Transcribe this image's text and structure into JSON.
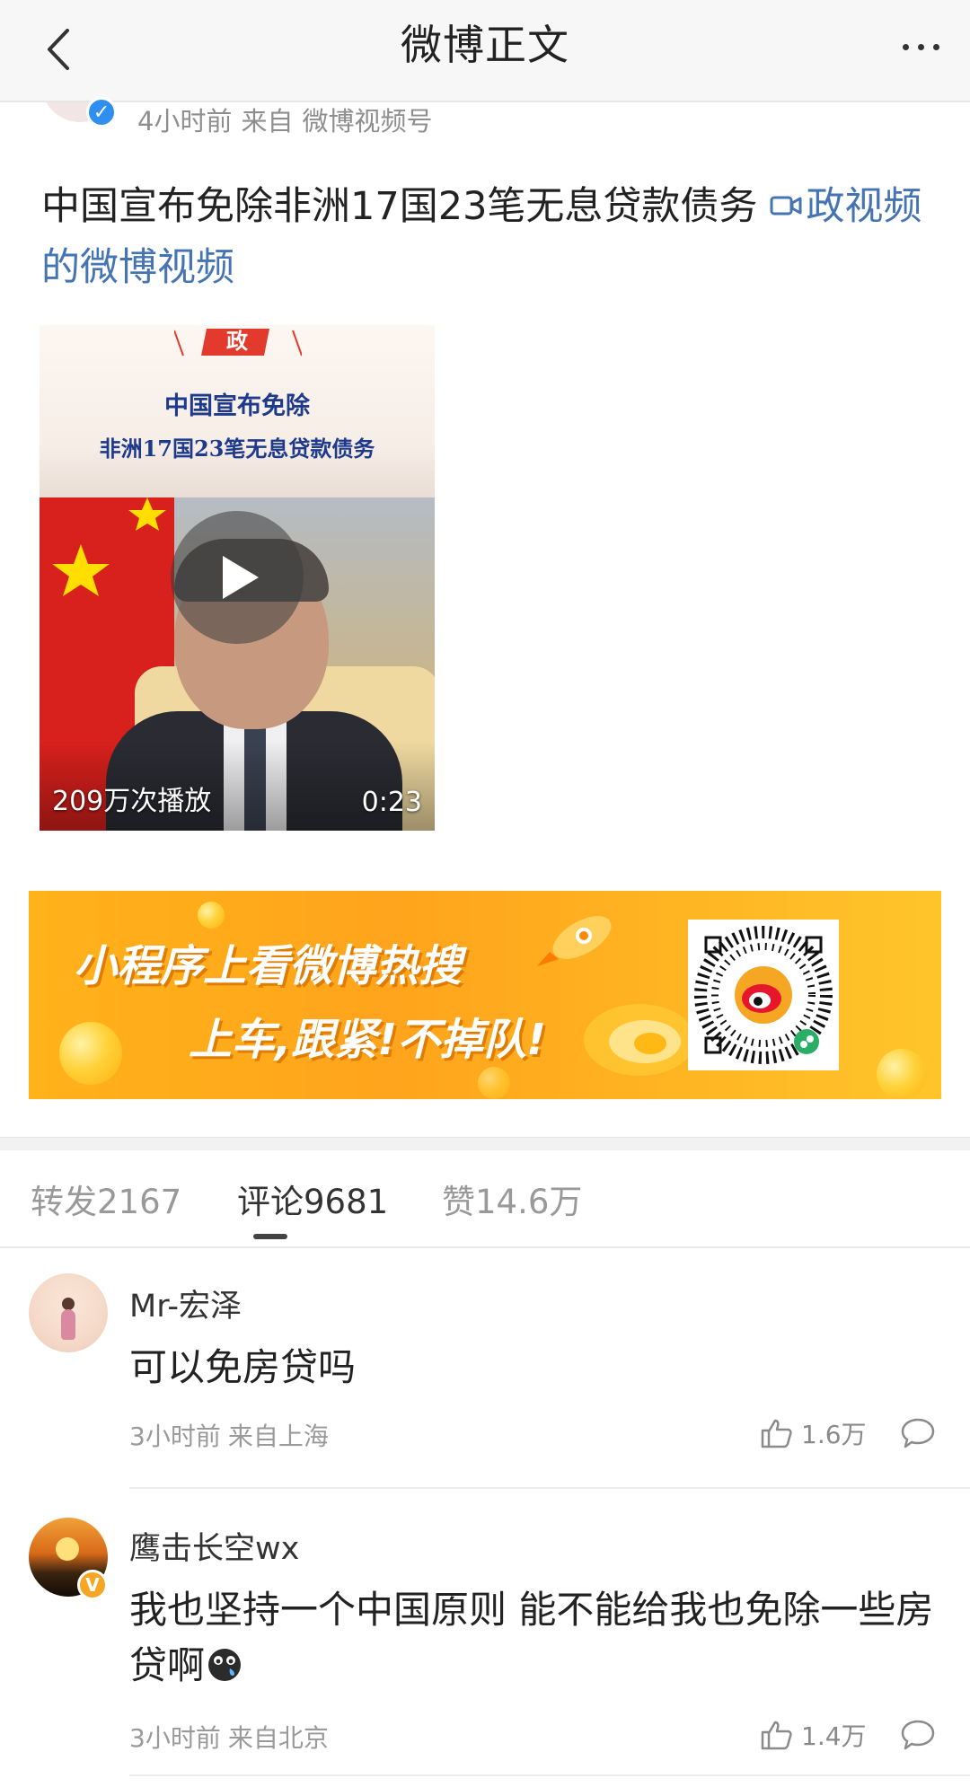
{
  "header": {
    "title": "微博正文"
  },
  "post": {
    "time": "4小时前",
    "source_prefix": "来自",
    "source": "微博视频号",
    "text": "中国宣布免除非洲17国23笔无息贷款债务",
    "video_link": "政视频的微博视频"
  },
  "video": {
    "caption_line1": "中国宣布免除",
    "caption_line2": "非洲17国23笔无息贷款债务",
    "logo_text": "政",
    "views": "209万次播放",
    "duration": "0:23"
  },
  "banner": {
    "line1": "小程序上看微博热搜",
    "line2": "上车,跟紧!不掉队!"
  },
  "tabs": [
    {
      "label": "转发2167"
    },
    {
      "label": "评论9681"
    },
    {
      "label": "赞14.6万"
    }
  ],
  "comments": [
    {
      "user": "Mr-宏泽",
      "text": "可以免房贷吗",
      "time": "3小时前",
      "source": "来自上海",
      "likes": "1.6万"
    },
    {
      "user": "鹰击长空wx",
      "text": "我也坚持一个中国原则 能不能给我也免除一些房贷啊",
      "time": "3小时前",
      "source": "来自北京",
      "likes": "1.4万"
    }
  ],
  "colors": {
    "link": "#4574b5",
    "banner": "#ffa41c",
    "verify_blue": "#2f8ff0",
    "verify_gold": "#f5a623"
  },
  "icons": [
    "back-arrow-icon",
    "more-dots-icon",
    "verified-badge-icon",
    "video-camera-icon",
    "play-icon",
    "thumbs-up-icon",
    "comment-bubble-icon",
    "crying-emoji-icon",
    "weibo-logo-icon",
    "qr-code-icon"
  ]
}
